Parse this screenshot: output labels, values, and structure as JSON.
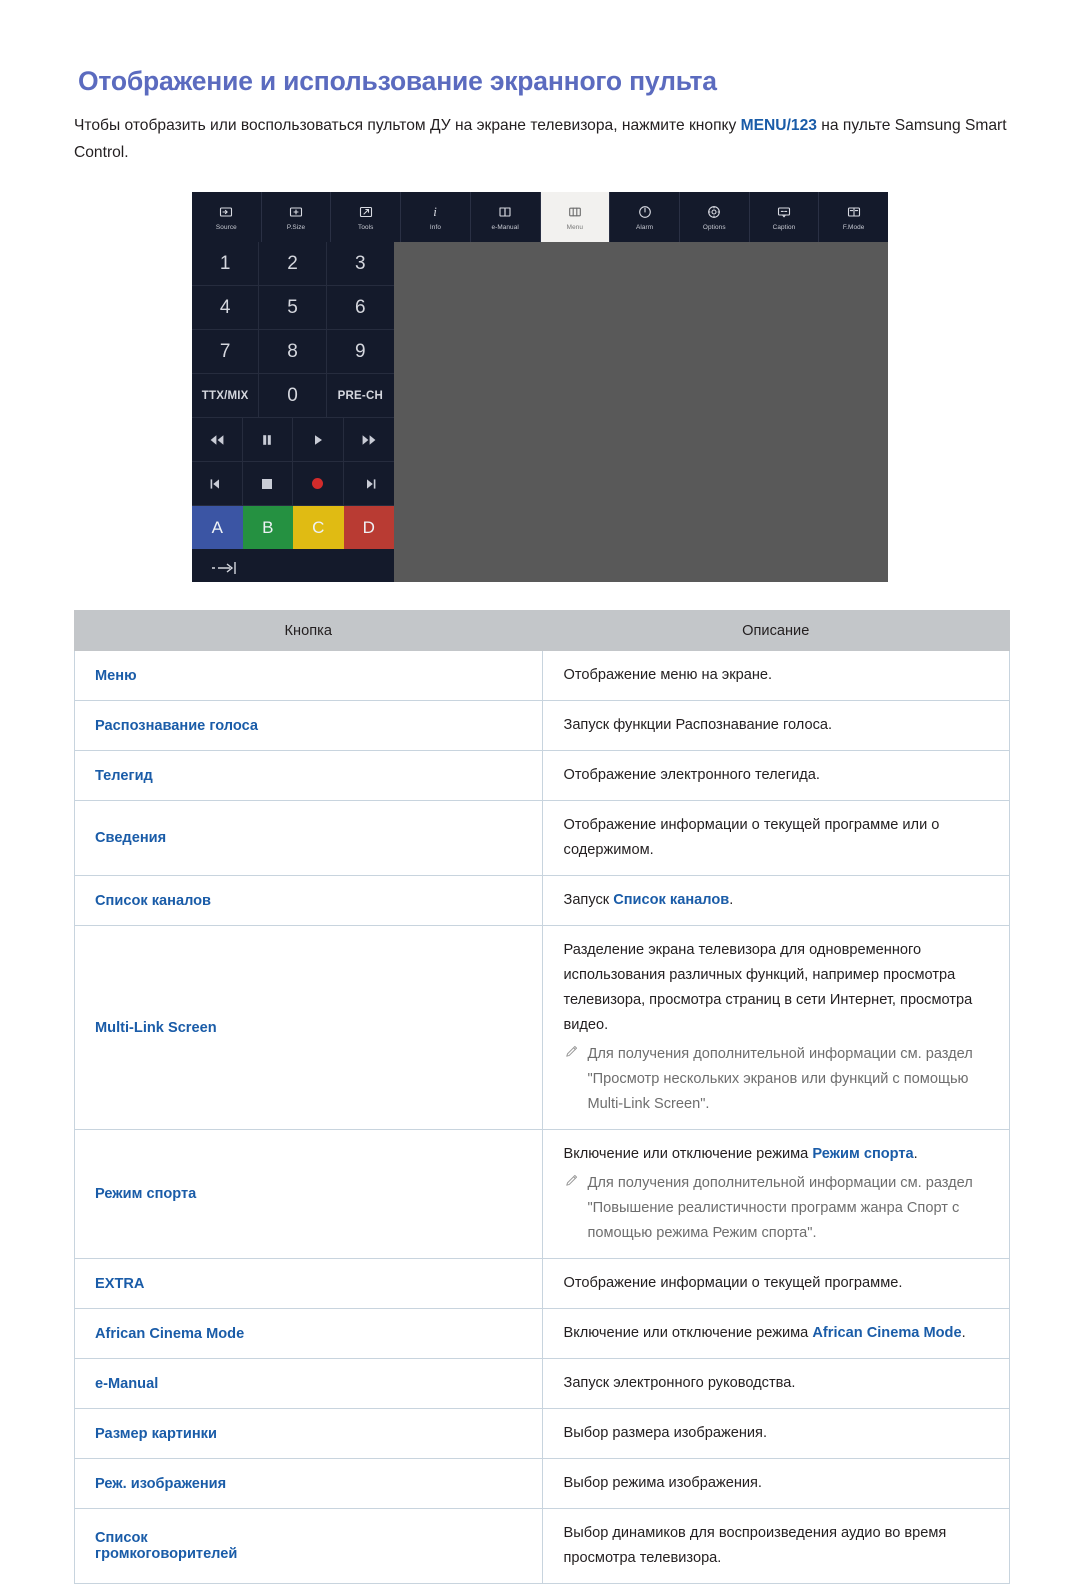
{
  "page": {
    "title": "Отображение и использование экранного пульта",
    "intro_before": "Чтобы отобразить или воспользоваться пультом ДУ на экране телевизора, нажмите кнопку ",
    "intro_highlight": "MENU/123",
    "intro_after": " на пульте Samsung Smart Control.",
    "accent_blue": "#1a5ca8",
    "title_color": "#5b6bbf"
  },
  "remote": {
    "panel_bg": "#595959",
    "dark_bg": "#141a2b",
    "toolbar": [
      {
        "label": "Source",
        "icon": "source-icon",
        "active": false
      },
      {
        "label": "P.Size",
        "icon": "picture-size-icon",
        "active": false
      },
      {
        "label": "Tools",
        "icon": "tools-icon",
        "active": false
      },
      {
        "label": "Info",
        "icon": "info-icon",
        "active": false
      },
      {
        "label": "e-Manual",
        "icon": "e-manual-icon",
        "active": false
      },
      {
        "label": "Menu",
        "icon": "menu-icon",
        "active": true
      },
      {
        "label": "Alarm",
        "icon": "alarm-power-icon",
        "active": false
      },
      {
        "label": "Options",
        "icon": "options-gear-icon",
        "active": false
      },
      {
        "label": "Caption",
        "icon": "caption-icon",
        "active": false
      },
      {
        "label": "F.Mode",
        "icon": "f-mode-icon",
        "active": false
      }
    ],
    "keypad": [
      "1",
      "2",
      "3",
      "4",
      "5",
      "6",
      "7",
      "8",
      "9",
      "TTX/MIX",
      "0",
      "PRE-CH"
    ],
    "media_row1": [
      "rewind-icon",
      "pause-icon",
      "play-icon",
      "fast-forward-icon"
    ],
    "media_row2": [
      "previous-track-icon",
      "stop-icon",
      "record-icon",
      "next-track-icon"
    ],
    "color_buttons": [
      {
        "label": "A",
        "color": "#3b55a4"
      },
      {
        "label": "B",
        "color": "#259141"
      },
      {
        "label": "C",
        "color": "#e0bb13"
      },
      {
        "label": "D",
        "color": "#b93b33"
      }
    ],
    "exit_icon": "exit-arrow-icon"
  },
  "table": {
    "headers": [
      "Кнопка",
      "Описание"
    ],
    "rows": [
      {
        "button": "Меню",
        "desc_parts": [
          {
            "t": "Отображение меню на экране.",
            "hl": false
          }
        ]
      },
      {
        "button": "Распознавание голоса",
        "desc_parts": [
          {
            "t": "Запуск функции Распознавание голоса.",
            "hl": false
          }
        ]
      },
      {
        "button": "Телегид",
        "desc_parts": [
          {
            "t": "Отображение электронного телегида.",
            "hl": false
          }
        ]
      },
      {
        "button": "Сведения",
        "desc_parts": [
          {
            "t": "Отображение информации о текущей программе или о содержимом.",
            "hl": false
          }
        ]
      },
      {
        "button": "Список каналов",
        "desc_parts": [
          {
            "t": "Запуск ",
            "hl": false
          },
          {
            "t": "Список каналов",
            "hl": true
          },
          {
            "t": ".",
            "hl": false
          }
        ]
      },
      {
        "button": "Multi-Link Screen",
        "desc_parts": [
          {
            "t": "Разделение экрана телевизора для одновременного использования различных функций, например просмотра телевизора, просмотра страниц в сети Интернет, просмотра видео.",
            "hl": false
          }
        ],
        "note": "Для получения дополнительной информации см. раздел \"Просмотр нескольких экранов или функций с помощью Multi-Link Screen\"."
      },
      {
        "button": "Режим спорта",
        "desc_parts": [
          {
            "t": "Включение или отключение режима ",
            "hl": false
          },
          {
            "t": "Режим спорта",
            "hl": true
          },
          {
            "t": ".",
            "hl": false
          }
        ],
        "note": "Для получения дополнительной информации см. раздел \"Повышение реалистичности программ жанра Спорт с помощью режима Режим спорта\"."
      },
      {
        "button": "EXTRA",
        "desc_parts": [
          {
            "t": "Отображение информации о текущей программе.",
            "hl": false
          }
        ]
      },
      {
        "button": "African Cinema Mode",
        "desc_parts": [
          {
            "t": "Включение или отключение режима ",
            "hl": false
          },
          {
            "t": "African Cinema Mode",
            "hl": true
          },
          {
            "t": ".",
            "hl": false
          }
        ]
      },
      {
        "button": "e-Manual",
        "desc_parts": [
          {
            "t": "Запуск электронного руководства.",
            "hl": false
          }
        ]
      },
      {
        "button": "Размер картинки",
        "desc_parts": [
          {
            "t": "Выбор размера изображения.",
            "hl": false
          }
        ]
      },
      {
        "button": "Реж. изображения",
        "desc_parts": [
          {
            "t": "Выбор режима изображения.",
            "hl": false
          }
        ]
      },
      {
        "button": "Список\nгромкоговорителей",
        "desc_parts": [
          {
            "t": "Выбор динамиков для воспроизведения аудио во время просмотра телевизора.",
            "hl": false
          }
        ]
      }
    ]
  }
}
